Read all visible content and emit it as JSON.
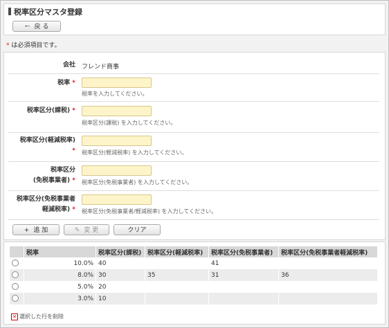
{
  "page": {
    "title": "税率区分マスタ登録"
  },
  "toolbar": {
    "back_label": "戻 る"
  },
  "required_note": {
    "asterisk": "*",
    "text": "は必須項目です。"
  },
  "form": {
    "company": {
      "label": "会社",
      "value": "フレンド商事"
    },
    "tax_rate": {
      "label": "税率",
      "required": "*",
      "hint": "税率を入力してください。"
    },
    "taxable": {
      "label": "税率区分(課税)",
      "required": "*",
      "hint": "税率区分(課税) を入力してください。"
    },
    "reduced": {
      "label_line1": "税率区分(軽減税率)",
      "required": "*",
      "hint": "税率区分(軽減税率) を入力してください。"
    },
    "exempt": {
      "label_line1": "税率区分",
      "label_line2": "(免税事業者)",
      "required": "*",
      "hint": "税率区分(免税事業者) を入力してください。"
    },
    "exempt_reduced": {
      "label_line1": "税率区分(免税事業者",
      "label_line2": "軽減税率)",
      "required": "*",
      "hint": "税率区分(免税事業者/軽減税率) を入力してください。"
    }
  },
  "actions": {
    "add_label": "追 加",
    "edit_label": "変 更",
    "clear_label": "クリア"
  },
  "table": {
    "headers": [
      "税率",
      "税率区分(課税)",
      "税率区分(軽減税率)",
      "税率区分(免税事業者)",
      "税率区分(免税事業者軽減税率)"
    ],
    "rows": [
      [
        "10.0%",
        "40",
        "",
        "41",
        ""
      ],
      [
        "8.0%",
        "30",
        "35",
        "31",
        "36"
      ],
      [
        "5.0%",
        "20",
        "",
        "",
        ""
      ],
      [
        "3.0%",
        "10",
        "",
        "",
        ""
      ]
    ],
    "delete_label": "選択した行を削除"
  },
  "colors": {
    "required": "#e02020",
    "input_bg": "#fdf5c9",
    "header_bg": "#d8d8d8"
  }
}
